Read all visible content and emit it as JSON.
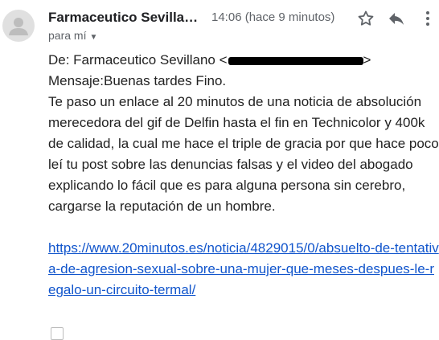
{
  "header": {
    "sender_name": "Farmaceutico Sevillano",
    "time": "14:06 (hace 9 minutos)",
    "recipient": "para mí"
  },
  "icons": {
    "star": "star-icon",
    "reply": "reply-icon",
    "more": "more-vert-icon"
  },
  "message": {
    "from_prefix": "De: Farmaceutico Sevillano <",
    "from_suffix": ">",
    "greeting": "Mensaje:Buenas tardes Fino.",
    "paragraph": "Te paso un enlace al 20 minutos de una noticia de absolución merecedora del gif de Delfin hasta el fin en Technicolor y 400k de calidad, la cual me hace el triple de gracia por que hace poco leí tu post sobre las denuncias falsas y el video del abogado explicando lo fácil que es para alguna persona sin cerebro, cargarse la reputación de un hombre.",
    "link": "https://www.20minutos.es/noticia/4829015/0/absuelto-de-tentativa-de-agresion-sexual-sobre-una-mujer-que-meses-despues-le-regalo-un-circuito-termal/"
  }
}
